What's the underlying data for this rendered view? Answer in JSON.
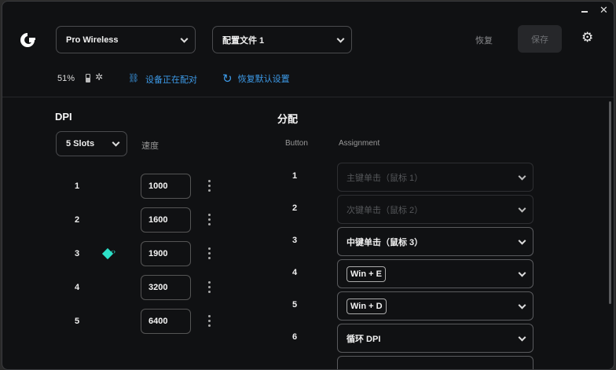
{
  "header": {
    "device": "Pro Wireless",
    "profile": "配置文件 1",
    "revert": "恢复",
    "save": "保存",
    "battery": "51%",
    "pairing": "设备正在配对",
    "restore_defaults": "恢复默认设置"
  },
  "dpi": {
    "title": "DPI",
    "slots": "5 Slots",
    "speed_label": "速度",
    "rows": [
      {
        "n": "1",
        "v": "1000"
      },
      {
        "n": "2",
        "v": "1600"
      },
      {
        "n": "3",
        "v": "1900"
      },
      {
        "n": "4",
        "v": "3200"
      },
      {
        "n": "5",
        "v": "6400"
      }
    ],
    "active_slot": 3
  },
  "assign": {
    "title": "分配",
    "col_button": "Button",
    "col_assignment": "Assignment",
    "rows": [
      {
        "n": "1",
        "v": "主键单击（鼠标 1）"
      },
      {
        "n": "2",
        "v": "次键单击（鼠标 2）"
      },
      {
        "n": "3",
        "v": "中键单击（鼠标 3）"
      },
      {
        "n": "4",
        "v": "Win + E"
      },
      {
        "n": "5",
        "v": "Win + D"
      },
      {
        "n": "6",
        "v": "循环 DPI"
      }
    ]
  },
  "colors": {
    "accent": "#3d9be9",
    "dpi_indicator": "#2de0c8"
  }
}
